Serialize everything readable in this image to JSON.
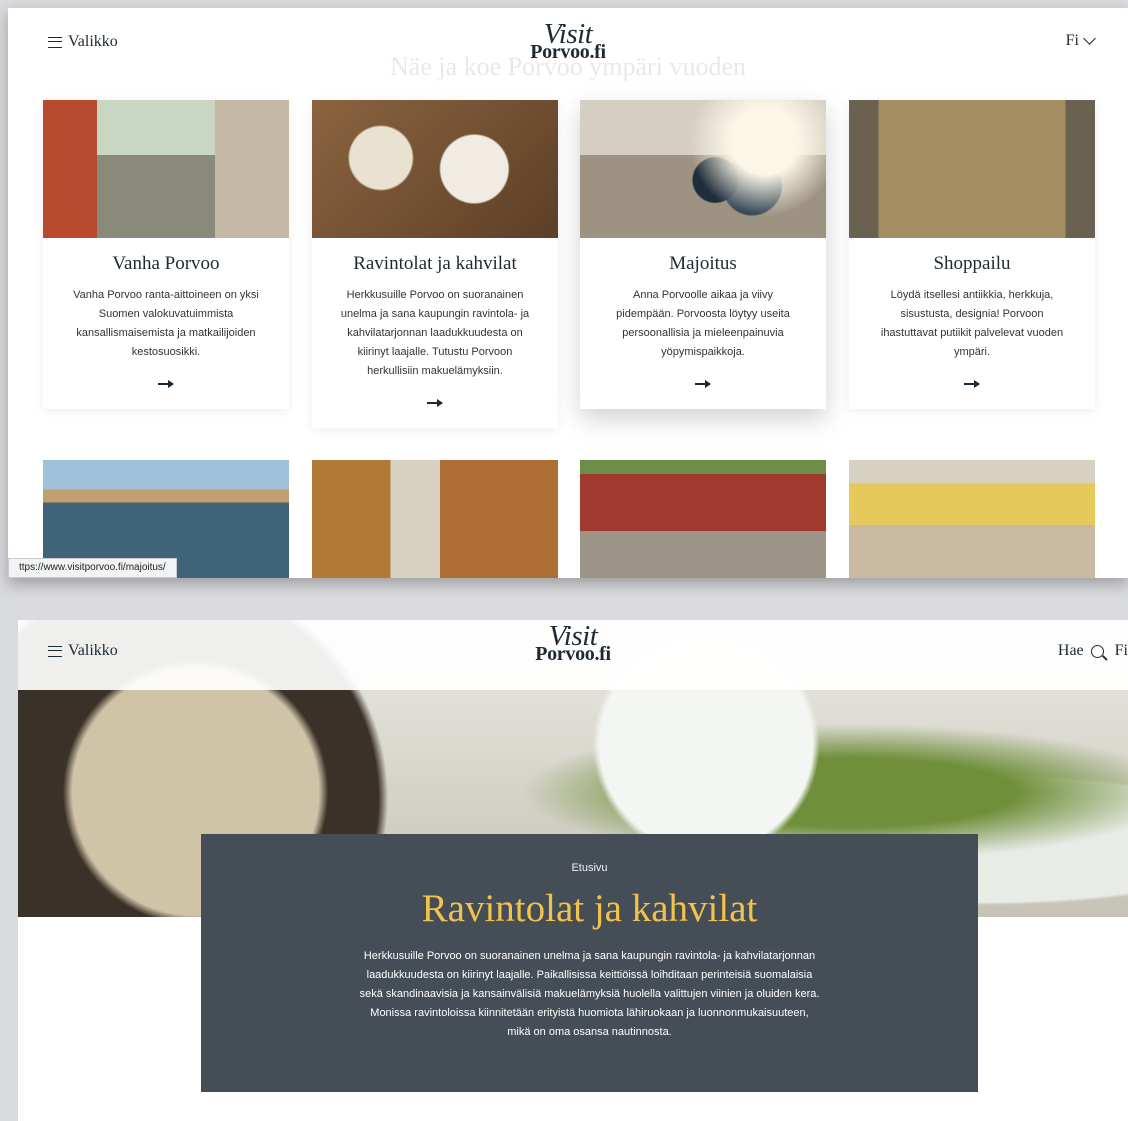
{
  "header": {
    "menu_label": "Valikko",
    "logo_line1": "Visit",
    "logo_line2": "Porvoo.fi",
    "lang_label": "Fi",
    "search_label": "Hae"
  },
  "overlap_title": "Näe ja koe Porvoo ympäri vuoden",
  "cards": [
    {
      "title": "Vanha Porvoo",
      "text": "Vanha Porvoo ranta-aittoineen on yksi Suomen valokuvatuimmista kansallismaisemista ja matkailijoiden kestosuosikki."
    },
    {
      "title": "Ravintolat ja kahvilat",
      "text": "Herkkusuille Porvoo on suoranainen unelma ja sana kaupungin ravintola- ja kahvilatarjonnan laadukkuudesta on kiirinyt laajalle. Tutustu Porvoon herkullisiin makuelämyksiin."
    },
    {
      "title": "Majoitus",
      "text": "Anna Porvoolle aikaa ja viivy pidempään. Porvoosta löytyy useita persoonallisia ja mieleenpainuvia yöpymispaikkoja."
    },
    {
      "title": "Shoppailu",
      "text": "Löydä itsellesi antiikkia, herkkuja, sisustusta, designia! Porvoon ihastuttavat putiikit palvelevat vuoden ympäri."
    }
  ],
  "status_url": "ttps://www.visitporvoo.fi/majoitus/",
  "hero": {
    "breadcrumb": "Etusivu",
    "title": "Ravintolat ja kahvilat",
    "text": "Herkkusuille Porvoo on suoranainen unelma ja sana kaupungin ravintola- ja kahvilatarjonnan laadukkuudesta on kiirinyt laajalle. Paikallisissa keittiöissä loihditaan perinteisiä suomalaisia sekä skandinaavisia ja kansainvälisiä makuelämyksiä huolella valittujen viinien ja oluiden kera. Monissa ravintoloissa kiinnitetään erityistä huomiota lähiruokaan ja luonnonmukaisuuteen, mikä on oma osansa nautinnosta."
  },
  "colors": {
    "text_dark": "#1d2a33",
    "hero_panel": "#454e57",
    "hero_title": "#f3c24a"
  }
}
